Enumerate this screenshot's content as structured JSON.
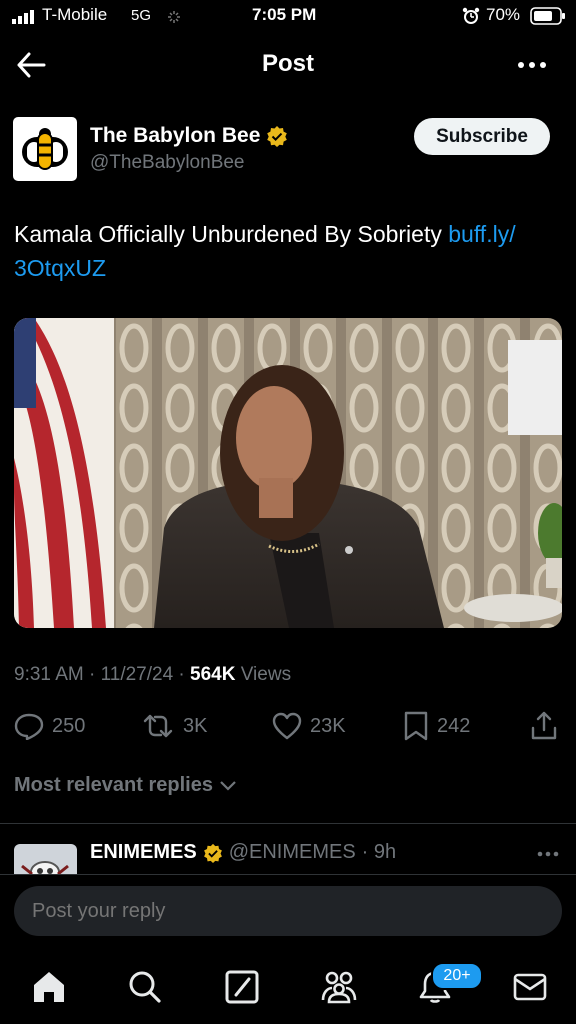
{
  "status": {
    "carrier": "T-Mobile",
    "network": "5G",
    "time": "7:05 PM",
    "battery": "70%"
  },
  "header": {
    "title": "Post"
  },
  "tweet": {
    "author_name": "The Babylon Bee",
    "author_handle": "@TheBabylonBee",
    "subscribe_label": "Subscribe",
    "text": "Kamala Officially Unburdened By Sobriety ",
    "link_line1": "buff.ly/",
    "link_line2": "3OtqxUZ",
    "timestamp": "9:31 AM · 11/27/24 · ",
    "views_count": "564K",
    "views_label": " Views"
  },
  "actions": {
    "replies": "250",
    "reposts": "3K",
    "likes": "23K",
    "bookmarks": "242"
  },
  "replies_sort": {
    "label": "Most relevant replies"
  },
  "reply_preview": {
    "name": "ENIMEMES",
    "handle": "@ENIMEMES",
    "age": "· 9h"
  },
  "compose": {
    "placeholder": "Post your reply"
  },
  "nav": {
    "notifications_badge": "20+"
  },
  "colors": {
    "background": "#000000",
    "accent": "#1d9bf0",
    "muted": "#71767b",
    "verified": "#e9b81b"
  }
}
